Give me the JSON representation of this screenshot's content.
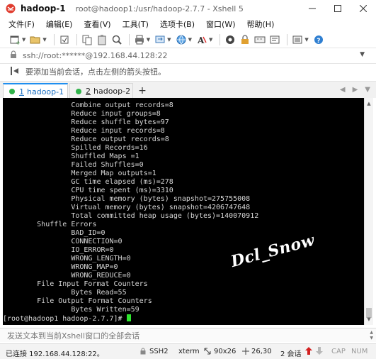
{
  "window": {
    "title": "hadoop-1",
    "path": "root@hadoop1:/usr/hadoop-2.7.7 - Xshell 5"
  },
  "menu": [
    "文件(F)",
    "编辑(E)",
    "查看(V)",
    "工具(T)",
    "选项卡(B)",
    "窗口(W)",
    "帮助(H)"
  ],
  "address": {
    "value": "ssh://root:******@192.168.44.128:22"
  },
  "hint": {
    "text": "要添加当前会话，点击左侧的箭头按钮。"
  },
  "tabs": [
    {
      "number": "1",
      "label": "hadoop-1",
      "status_color": "#30b34a",
      "active": true
    },
    {
      "number": "2",
      "label": "hadoop-2",
      "status_color": "#30b34a",
      "active": false
    }
  ],
  "terminal": {
    "lines": [
      "\t\tCombine output records=8",
      "\t\tReduce input groups=8",
      "\t\tReduce shuffle bytes=97",
      "\t\tReduce input records=8",
      "\t\tReduce output records=8",
      "\t\tSpilled Records=16",
      "\t\tShuffled Maps =1",
      "\t\tFailed Shuffles=0",
      "\t\tMerged Map outputs=1",
      "\t\tGC time elapsed (ms)=278",
      "\t\tCPU time spent (ms)=3310",
      "\t\tPhysical memory (bytes) snapshot=275755008",
      "\t\tVirtual memory (bytes) snapshot=4206747648",
      "\t\tTotal committed heap usage (bytes)=140070912",
      "\tShuffle Errors",
      "\t\tBAD_ID=0",
      "\t\tCONNECTION=0",
      "\t\tIO_ERROR=0",
      "\t\tWRONG_LENGTH=0",
      "\t\tWRONG_MAP=0",
      "\t\tWRONG_REDUCE=0",
      "\tFile Input Format Counters",
      "\t\tBytes Read=55",
      "\tFile Output Format Counters",
      "\t\tBytes Written=59"
    ],
    "prompt": "[root@hadoop1 hadoop-2.7.7]# ",
    "watermark": "Dcl_Snow",
    "cursor_color": "#2ee62e"
  },
  "compose": {
    "placeholder": "发送文本到当前Xshell窗口的全部会话"
  },
  "status": {
    "connection": "已连接 192.168.44.128:22。",
    "protocol": "SSH2",
    "terminal_type": "xterm",
    "size": "90x26",
    "cursor_pos": "26,30",
    "sessions": "2 会话",
    "cap": "CAP",
    "num": "NUM"
  }
}
